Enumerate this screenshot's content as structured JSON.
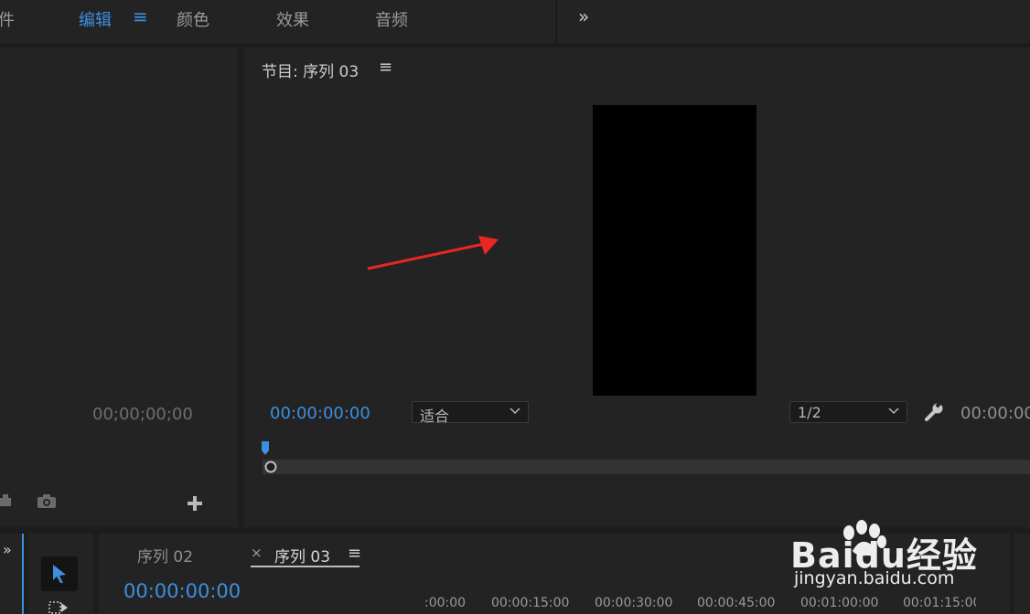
{
  "workspace": {
    "tabs": [
      {
        "label": "件"
      },
      {
        "label": "编辑"
      },
      {
        "label": "颜色"
      },
      {
        "label": "效果"
      },
      {
        "label": "音频"
      }
    ],
    "more": "»"
  },
  "source_panel": {
    "timecode": "00;00;00;00"
  },
  "program_monitor": {
    "title": "节目: 序列 03",
    "menu": "≡",
    "current_time": "00:00:00:00",
    "fit_select": "适合",
    "resolution_select": "1/2",
    "duration": "00:00:00"
  },
  "timeline": {
    "tabs": [
      {
        "label": "序列 02"
      },
      {
        "label": "序列 03"
      }
    ],
    "close": "×",
    "menu": "≡",
    "timecode": "00:00:00:00",
    "ruler": [
      ":00:00",
      "00:00:15:00",
      "00:00:30:00",
      "00:00:45:00",
      "00:01:00:00",
      "00:01:15:00"
    ]
  },
  "watermark": {
    "brand": "Baidu经验",
    "url": "jingyan.baidu.com"
  },
  "colors": {
    "accent": "#3d8fe0",
    "annotation_arrow": "#e8271f"
  }
}
